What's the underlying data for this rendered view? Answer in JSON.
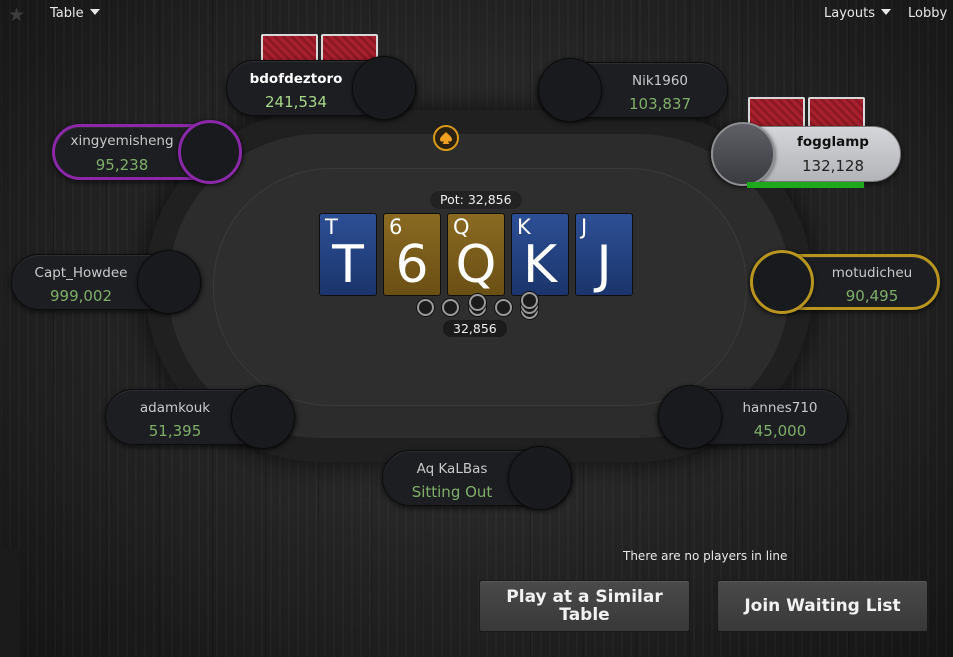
{
  "topbar": {
    "table_label": "Table",
    "layouts_label": "Layouts",
    "lobby_label": "Lobby"
  },
  "pot": {
    "label": "Pot: 32,856",
    "amount": "32,856"
  },
  "board": [
    {
      "rank": "T",
      "color": "blue"
    },
    {
      "rank": "6",
      "color": "gold"
    },
    {
      "rank": "Q",
      "color": "gold"
    },
    {
      "rank": "K",
      "color": "blue"
    },
    {
      "rank": "J",
      "color": "blue"
    }
  ],
  "seats": {
    "bdofdeztoro": {
      "name": "bdofdeztoro",
      "stack": "241,534"
    },
    "nik1960": {
      "name": "Nik1960",
      "stack": "103,837"
    },
    "xingyemisheng": {
      "name": "xingyemisheng",
      "stack": "95,238"
    },
    "fogglamp": {
      "name": "fogglamp",
      "stack": "132,128"
    },
    "capt_howdee": {
      "name": "Capt_Howdee",
      "stack": "999,002"
    },
    "motudicheu": {
      "name": "motudicheu",
      "stack": "90,495"
    },
    "adamkouk": {
      "name": "adamkouk",
      "stack": "51,395"
    },
    "hannes710": {
      "name": "hannes710",
      "stack": "45,000"
    },
    "aq_kalbas": {
      "name": "Aq KaLBas",
      "stack": "Sitting Out"
    }
  },
  "waitlist": {
    "status": "There are no players in line",
    "play_similar_label": "Play at a Similar Table",
    "join_waiting_label": "Join Waiting List"
  },
  "colors": {
    "active_purple": "#8a28a8",
    "active_gold": "#b8951e",
    "timer_green": "#1ea81e",
    "stack_green": "#7fae6a"
  }
}
